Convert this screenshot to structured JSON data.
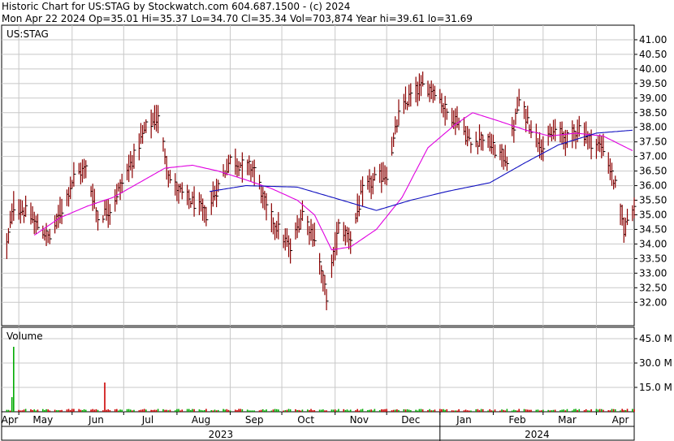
{
  "header": {
    "line1": "Historic Chart for US:STAG by Stockwatch.com 604.687.1500 - (c) 2024",
    "line2": "Mon Apr 22 2024   Op=35.01   Hi=35.37   Lo=34.70   Cl=35.34   Vol=703,874   Year hi=39.61   lo=31.69"
  },
  "colors": {
    "price_bar": "#8b0000",
    "close_tick": "#000000",
    "ma_short": "#e000e0",
    "ma_long": "#1010c0",
    "volume_up": "#00aa00",
    "volume_down": "#cc0000",
    "grid": "#c8c8c8"
  },
  "chart_data": [
    {
      "type": "ohlc",
      "title": "US:STAG",
      "ylim": [
        31.2,
        41.5
      ],
      "y_ticks": [
        "41.00",
        "40.50",
        "40.00",
        "39.50",
        "39.00",
        "38.50",
        "38.00",
        "37.50",
        "37.00",
        "36.50",
        "36.00",
        "35.50",
        "35.00",
        "34.50",
        "34.00",
        "33.50",
        "33.00",
        "32.50",
        "32.00"
      ],
      "x_month_labels": [
        "Apr",
        "May",
        "Jun",
        "Jul",
        "Aug",
        "Sep",
        "Oct",
        "Nov",
        "Dec",
        "Jan",
        "Feb",
        "Mar",
        "Apr"
      ],
      "x_year_labels": [
        "2023",
        "2024"
      ],
      "close_anchors": [
        [
          "2023-04-24",
          34.0
        ],
        [
          "2023-04-28",
          35.3
        ],
        [
          "2023-05-05",
          35.1
        ],
        [
          "2023-05-12",
          34.6
        ],
        [
          "2023-05-19",
          34.2
        ],
        [
          "2023-05-26",
          35.2
        ],
        [
          "2023-06-02",
          36.3
        ],
        [
          "2023-06-09",
          36.6
        ],
        [
          "2023-06-16",
          34.9
        ],
        [
          "2023-06-23",
          35.2
        ],
        [
          "2023-06-30",
          36.1
        ],
        [
          "2023-07-07",
          37.0
        ],
        [
          "2023-07-14",
          38.0
        ],
        [
          "2023-07-21",
          38.3
        ],
        [
          "2023-07-28",
          36.2
        ],
        [
          "2023-08-04",
          35.7
        ],
        [
          "2023-08-11",
          35.4
        ],
        [
          "2023-08-18",
          35.0
        ],
        [
          "2023-08-25",
          36.0
        ],
        [
          "2023-09-01",
          36.9
        ],
        [
          "2023-09-08",
          36.7
        ],
        [
          "2023-09-15",
          36.6
        ],
        [
          "2023-09-22",
          35.2
        ],
        [
          "2023-09-29",
          34.5
        ],
        [
          "2023-10-06",
          33.8
        ],
        [
          "2023-10-13",
          35.1
        ],
        [
          "2023-10-20",
          34.2
        ],
        [
          "2023-10-27",
          32.2
        ],
        [
          "2023-11-03",
          34.6
        ],
        [
          "2023-11-10",
          34.2
        ],
        [
          "2023-11-17",
          35.8
        ],
        [
          "2023-11-24",
          36.2
        ],
        [
          "2023-12-01",
          36.4
        ],
        [
          "2023-12-08",
          38.4
        ],
        [
          "2023-12-15",
          39.1
        ],
        [
          "2023-12-22",
          39.4
        ],
        [
          "2023-12-29",
          39.3
        ],
        [
          "2024-01-05",
          38.5
        ],
        [
          "2024-01-12",
          38.2
        ],
        [
          "2024-01-19",
          37.4
        ],
        [
          "2024-01-26",
          37.7
        ],
        [
          "2024-02-02",
          37.2
        ],
        [
          "2024-02-09",
          36.9
        ],
        [
          "2024-02-16",
          38.9
        ],
        [
          "2024-02-23",
          38.0
        ],
        [
          "2024-03-01",
          37.3
        ],
        [
          "2024-03-08",
          37.9
        ],
        [
          "2024-03-15",
          37.6
        ],
        [
          "2024-03-22",
          38.0
        ],
        [
          "2024-03-29",
          37.5
        ],
        [
          "2024-04-05",
          37.3
        ],
        [
          "2024-04-12",
          36.0
        ],
        [
          "2024-04-17",
          34.5
        ],
        [
          "2024-04-22",
          35.34
        ]
      ],
      "ma_short_anchors": [
        [
          "2023-05-10",
          34.3
        ],
        [
          "2023-05-25",
          34.9
        ],
        [
          "2023-06-10",
          35.3
        ],
        [
          "2023-06-25",
          35.6
        ],
        [
          "2023-07-10",
          36.1
        ],
        [
          "2023-07-25",
          36.6
        ],
        [
          "2023-08-10",
          36.7
        ],
        [
          "2023-08-25",
          36.5
        ],
        [
          "2023-09-10",
          36.2
        ],
        [
          "2023-09-25",
          35.9
        ],
        [
          "2023-10-10",
          35.5
        ],
        [
          "2023-10-20",
          35.0
        ],
        [
          "2023-10-30",
          33.8
        ],
        [
          "2023-11-10",
          33.9
        ],
        [
          "2023-11-25",
          34.5
        ],
        [
          "2023-12-10",
          35.6
        ],
        [
          "2023-12-25",
          37.3
        ],
        [
          "2024-01-10",
          38.1
        ],
        [
          "2024-01-20",
          38.5
        ],
        [
          "2024-02-05",
          38.2
        ],
        [
          "2024-02-20",
          37.9
        ],
        [
          "2024-03-05",
          37.7
        ],
        [
          "2024-03-20",
          37.8
        ],
        [
          "2024-04-05",
          37.7
        ],
        [
          "2024-04-22",
          37.2
        ]
      ],
      "ma_long_anchors": [
        [
          "2023-08-20",
          35.8
        ],
        [
          "2023-09-10",
          36.0
        ],
        [
          "2023-10-10",
          35.95
        ],
        [
          "2023-11-05",
          35.5
        ],
        [
          "2023-11-25",
          35.15
        ],
        [
          "2023-12-15",
          35.5
        ],
        [
          "2024-01-05",
          35.8
        ],
        [
          "2024-01-30",
          36.1
        ],
        [
          "2024-02-20",
          36.8
        ],
        [
          "2024-03-10",
          37.4
        ],
        [
          "2024-04-01",
          37.8
        ],
        [
          "2024-04-22",
          37.9
        ]
      ]
    },
    {
      "type": "bar",
      "title": "Volume",
      "ylim": [
        0,
        52
      ],
      "y_ticks": [
        "45.0 M",
        "30.0 M",
        "15.0 M"
      ],
      "spikes": [
        [
          "2023-04-28",
          40,
          "up"
        ],
        [
          "2023-06-20",
          18,
          "down"
        ],
        [
          "2023-04-27",
          9,
          "up"
        ]
      ],
      "baseline_volume": 1.2
    }
  ]
}
